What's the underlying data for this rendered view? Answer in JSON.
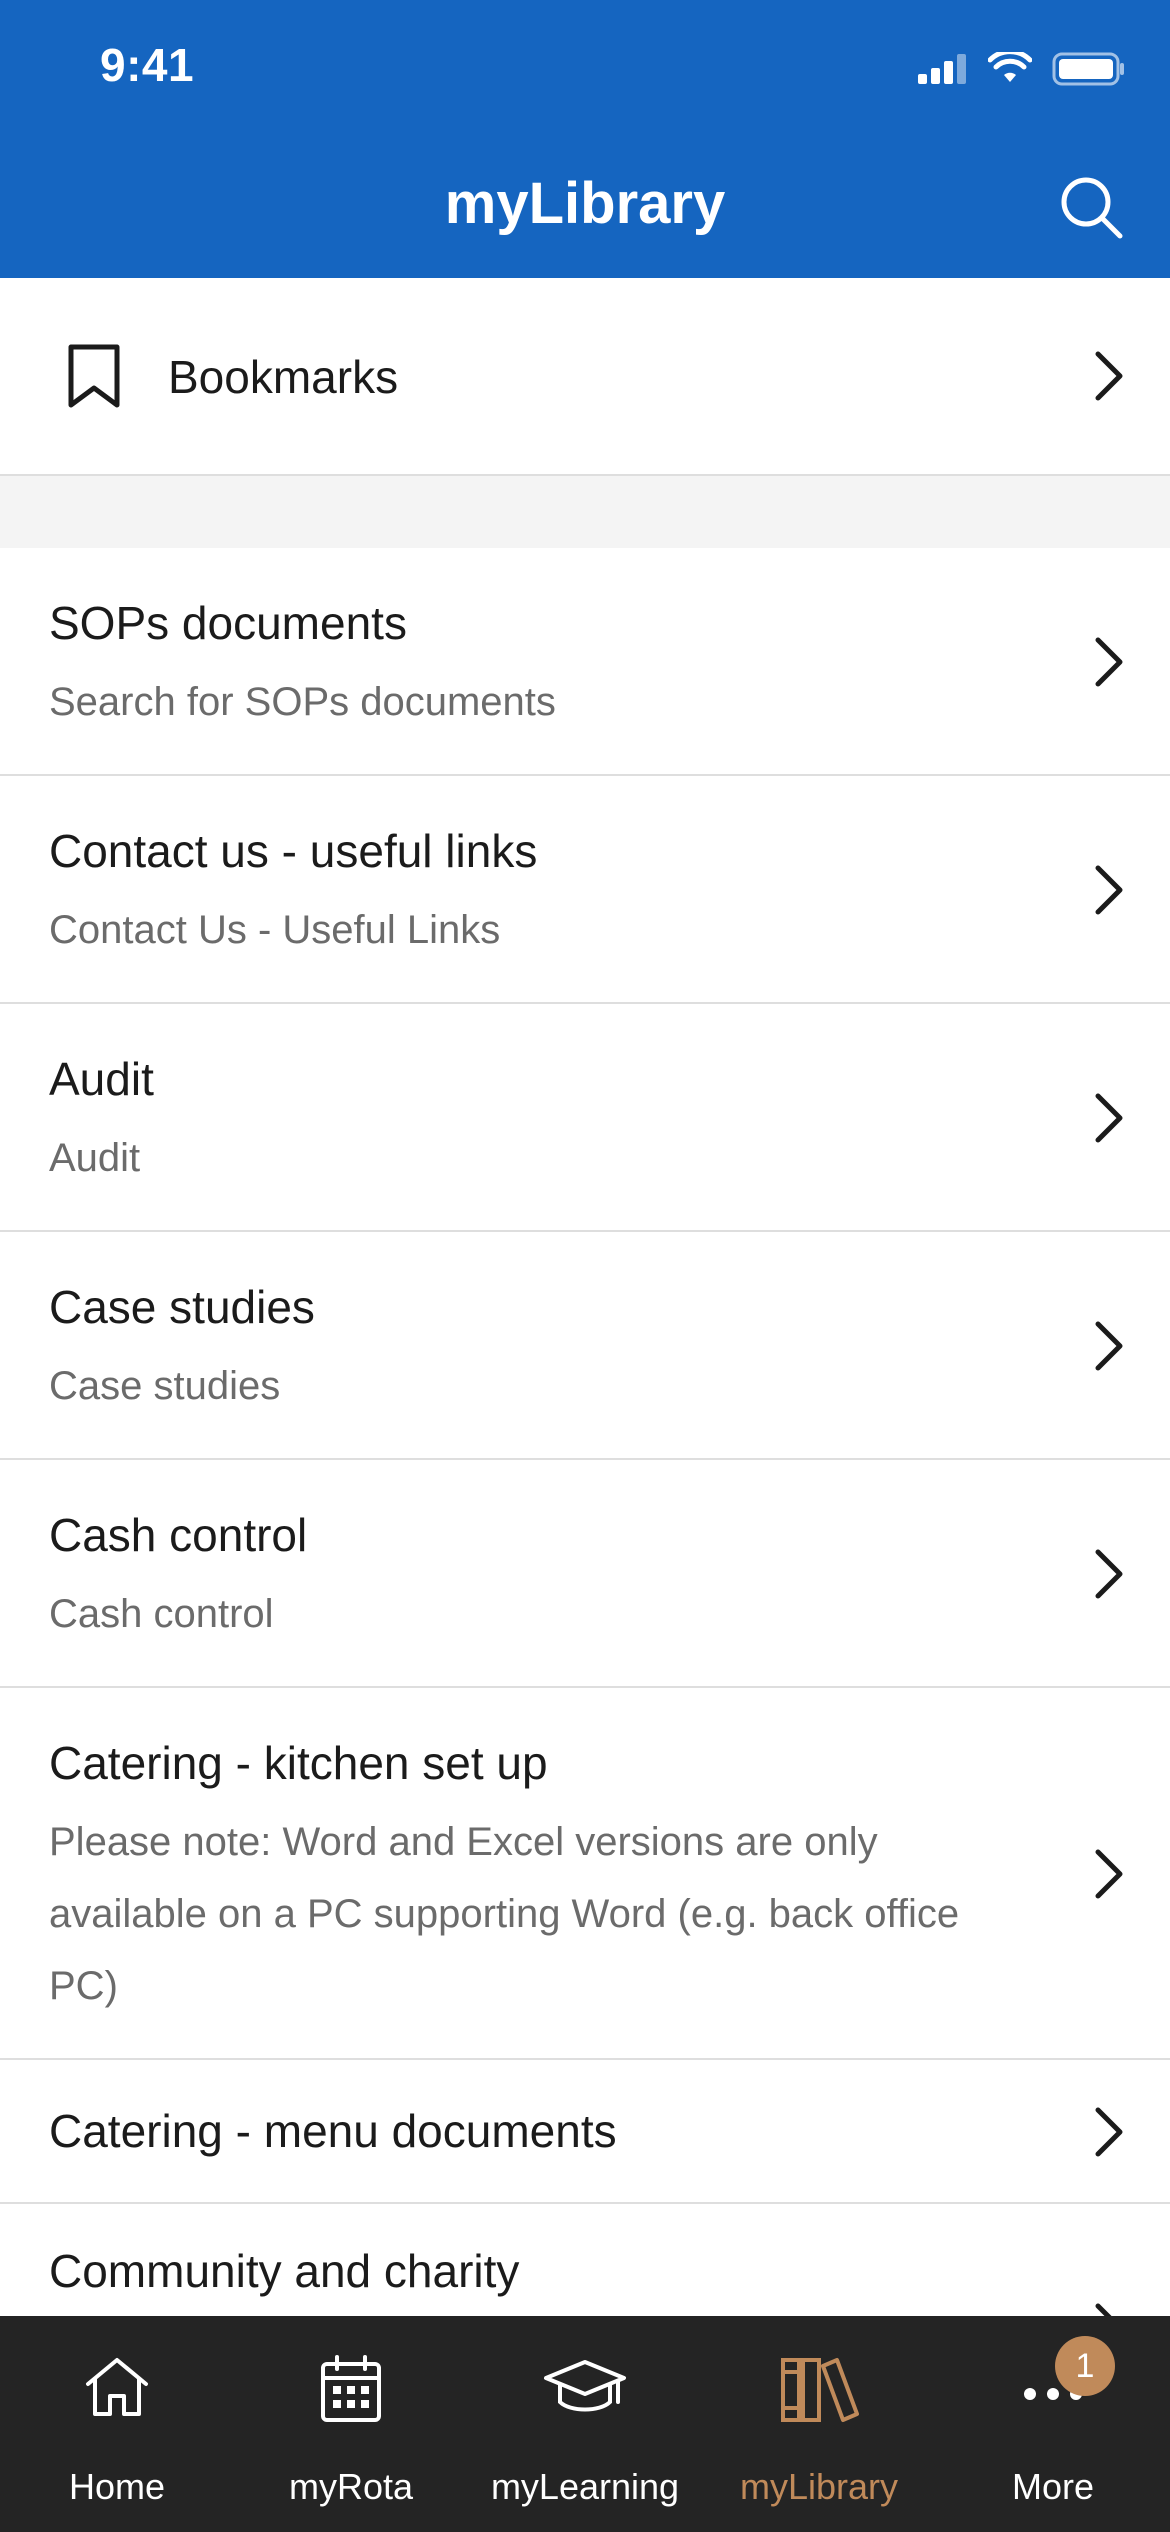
{
  "status_bar": {
    "time": "9:41"
  },
  "header": {
    "title": "myLibrary"
  },
  "bookmarks": {
    "label": "Bookmarks"
  },
  "items": [
    {
      "title": "SOPs documents",
      "subtitle": "Search for SOPs documents"
    },
    {
      "title": "Contact us - useful links",
      "subtitle": "Contact Us - Useful Links"
    },
    {
      "title": "Audit",
      "subtitle": "Audit"
    },
    {
      "title": "Case studies",
      "subtitle": "Case studies"
    },
    {
      "title": "Cash control",
      "subtitle": "Cash control"
    },
    {
      "title": "Catering - kitchen set up",
      "subtitle": "Please note: Word and Excel versions are only available on a PC supporting Word (e.g. back office PC)"
    },
    {
      "title": "Catering - menu documents",
      "subtitle": ""
    },
    {
      "title": "Community and charity",
      "subtitle": ""
    }
  ],
  "tabs": [
    {
      "label": "Home",
      "icon": "home-icon"
    },
    {
      "label": "myRota",
      "icon": "calendar-icon"
    },
    {
      "label": "myLearning",
      "icon": "graduation-cap-icon"
    },
    {
      "label": "myLibrary",
      "icon": "books-icon"
    },
    {
      "label": "More",
      "icon": "more-icon",
      "badge": "1"
    }
  ],
  "colors": {
    "header": "#1565c0",
    "tabbar": "#242424",
    "active_tab": "#c08a5a",
    "badge": "#c08a5a"
  }
}
